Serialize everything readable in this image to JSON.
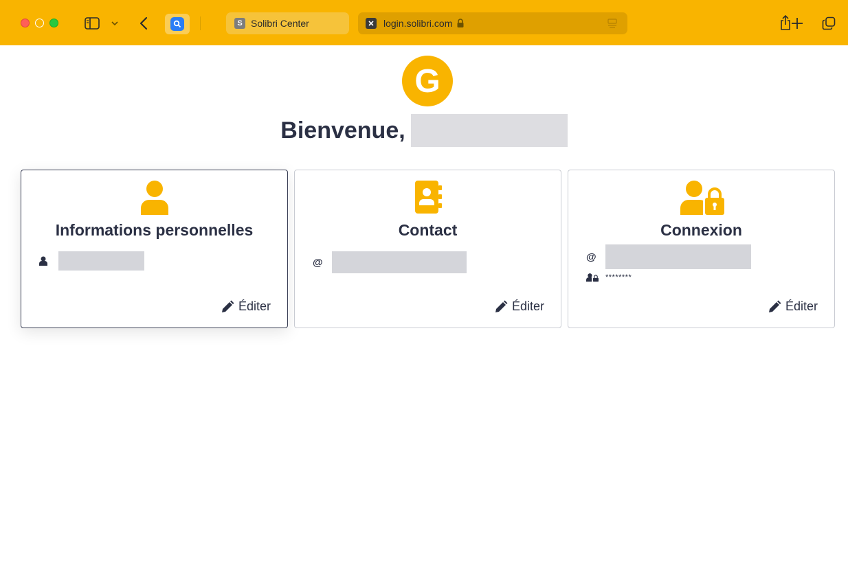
{
  "browser": {
    "tabs": [
      {
        "label": "Solibri Center",
        "favicon": "S",
        "active": false
      },
      {
        "label": "login.solibri.com",
        "active": true
      }
    ],
    "icons": [
      "sidebar-icon",
      "chevron-down-icon",
      "back-icon",
      "extension-icon",
      "lock-icon",
      "reader-icon",
      "share-icon",
      "plus-icon",
      "tab-overview-icon"
    ],
    "accent_color": "#f9b400"
  },
  "page": {
    "avatar_letter": "G",
    "welcome": "Bienvenue,",
    "cards": [
      {
        "title": "Informations personnelles",
        "icon": "user-icon",
        "rows": [
          {
            "icon": "user-small-icon",
            "value": ""
          }
        ],
        "edit_label": "Éditer"
      },
      {
        "title": "Contact",
        "icon": "address-book-icon",
        "rows": [
          {
            "icon": "at-icon",
            "glyph": "@",
            "value": ""
          }
        ],
        "edit_label": "Éditer"
      },
      {
        "title": "Connexion",
        "icon": "user-lock-icon",
        "rows": [
          {
            "icon": "at-icon",
            "glyph": "@",
            "value": ""
          },
          {
            "icon": "user-lock-small-icon",
            "value": "********"
          }
        ],
        "edit_label": "Éditer"
      }
    ]
  }
}
